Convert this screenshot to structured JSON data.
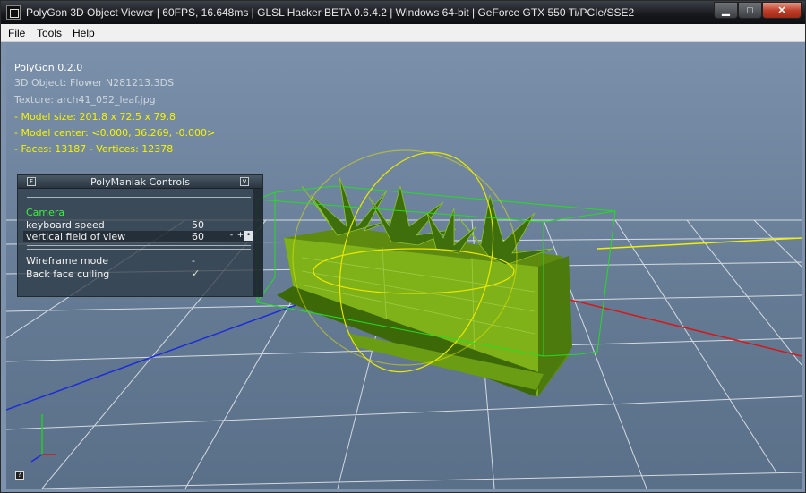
{
  "window": {
    "title": "PolyGon 3D Object Viewer | 60FPS, 16.648ms | GLSL Hacker BETA 0.6.4.2 | Windows 64-bit | GeForce GTX 550 Ti/PCIe/SSE2",
    "minimize_glyph": "▁",
    "maximize_glyph": "□",
    "close_glyph": "✕"
  },
  "menu": {
    "file": "File",
    "tools": "Tools",
    "help": "Help"
  },
  "info": {
    "app_version": "PolyGon 0.2.0",
    "object": "3D Object: Flower N281213.3DS",
    "texture": "Texture: arch41_052_leaf.jpg",
    "model_size": "- Model size:  201.8 x 72.5 x 79.8",
    "model_center": "- Model center:  <0.000, 36.269, -0.000>",
    "faces_vertices": "- Faces: 13187 - Vertices: 12378"
  },
  "controls": {
    "title": "PolyManiak Controls",
    "f_glyph": "F",
    "v_glyph": "v",
    "camera_section": "Camera",
    "keyboard_speed_label": "keyboard speed",
    "keyboard_speed_value": "50",
    "fov_label": "vertical field of view",
    "fov_value": "60",
    "minus_glyph": "-",
    "plus_glyph": "+",
    "wireframe_label": "Wireframe mode",
    "wireframe_value": "-",
    "backface_label": "Back face culling",
    "backface_value": "✓"
  },
  "help_glyph": "?",
  "colors": {
    "info_yellow": "#f7f400",
    "section_green": "#3cf040",
    "bbox_green": "#22dd22",
    "gizmo_yellow": "#e8e800"
  }
}
